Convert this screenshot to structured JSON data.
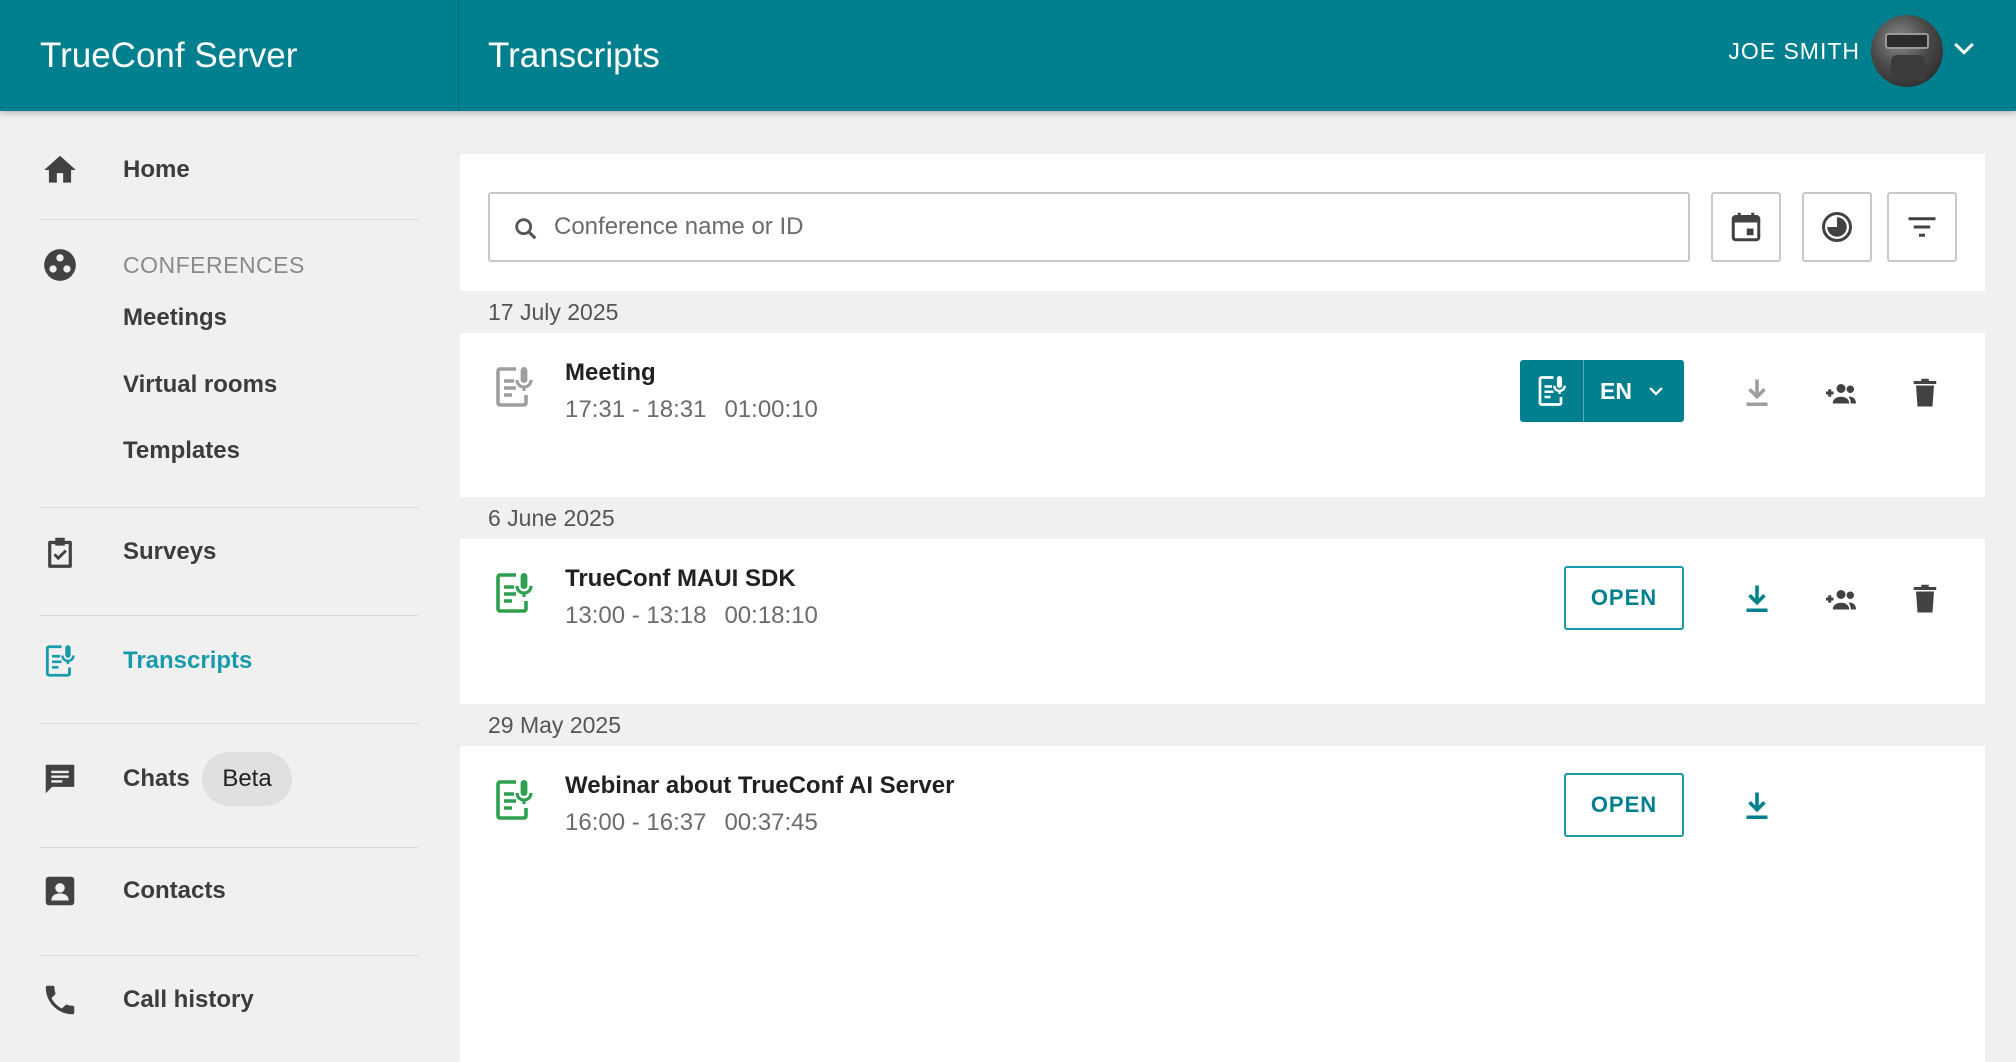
{
  "header": {
    "brand": "TrueConf Server",
    "title": "Transcripts",
    "user_name": "JOE SMITH"
  },
  "sidebar": {
    "home": "Home",
    "conferences_title": "CONFERENCES",
    "meetings": "Meetings",
    "virtual_rooms": "Virtual rooms",
    "templates": "Templates",
    "surveys": "Surveys",
    "transcripts": "Transcripts",
    "chats": "Chats",
    "chats_badge": "Beta",
    "contacts": "Contacts",
    "call_history": "Call history"
  },
  "search": {
    "placeholder": "Conference name or ID",
    "value": ""
  },
  "groups": [
    {
      "date": "17 July 2025",
      "item": {
        "title": "Meeting",
        "time": "17:31 - 18:31",
        "duration": "01:00:10",
        "language": "EN"
      }
    },
    {
      "date": "6 June 2025",
      "item": {
        "title": "TrueConf MAUI SDK",
        "time": "13:00 - 13:18",
        "duration": "00:18:10",
        "open_label": "OPEN"
      }
    },
    {
      "date": "29 May 2025",
      "item": {
        "title": "Webinar about TrueConf AI Server",
        "time": "16:00 - 16:37",
        "duration": "00:37:45",
        "open_label": "OPEN"
      }
    }
  ],
  "colors": {
    "header": "#00808f",
    "accent": "#1a9bab",
    "transcript_green": "#2e9e4f",
    "icon_grey": "#424242",
    "disabled_grey": "#9e9e9e"
  },
  "icons": {
    "home": "home-icon",
    "conferences": "conferences-icon",
    "surveys": "clipboard-check-icon",
    "transcripts": "transcript-icon",
    "chats": "chat-icon",
    "contacts": "contact-card-icon",
    "call_history": "phone-icon",
    "calendar": "calendar-icon",
    "duration": "clock-pie-icon",
    "filter": "filter-icon",
    "download": "download-icon",
    "add_participants": "add-group-icon",
    "delete": "trash-icon"
  }
}
